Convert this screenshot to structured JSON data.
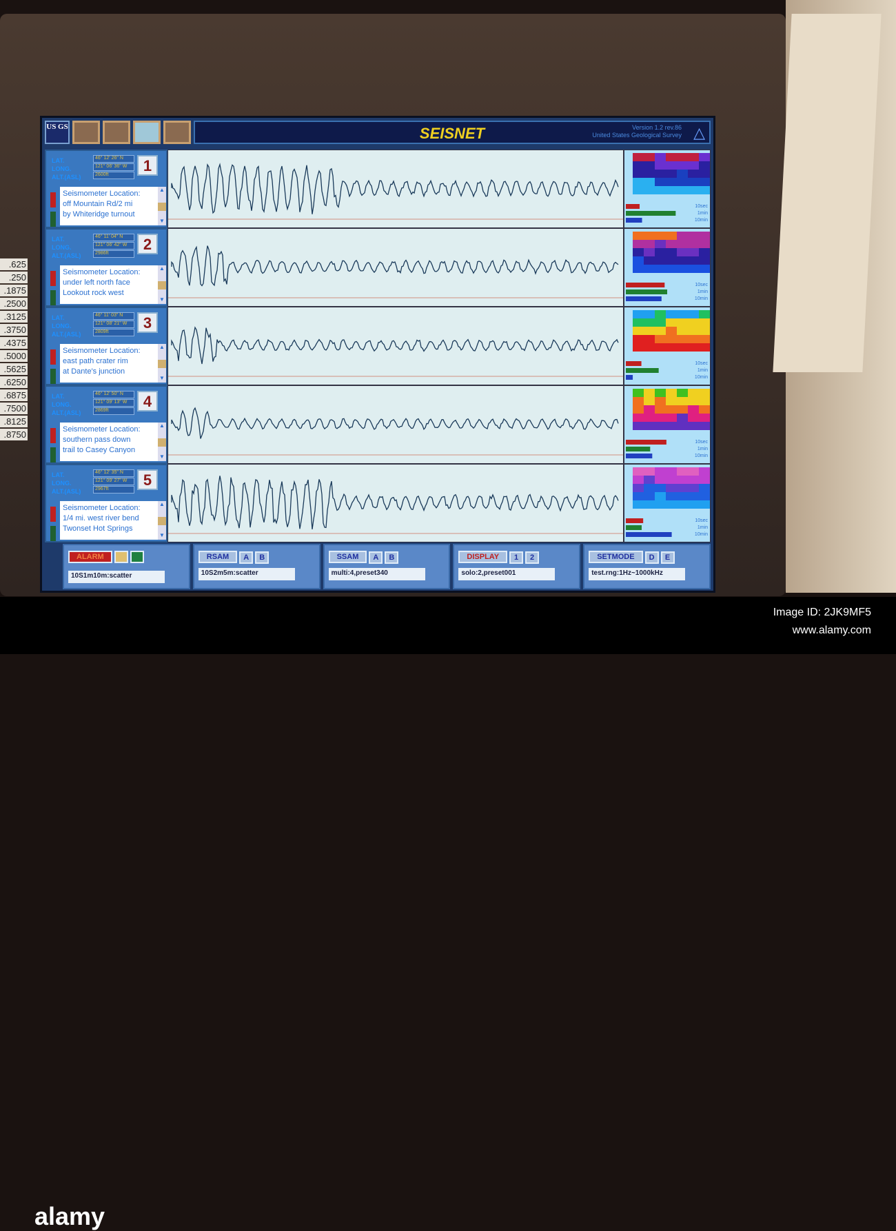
{
  "scale_labels": [
    ".625",
    ".250",
    ".1875",
    ".2500",
    ".3125",
    ".3750",
    ".4375",
    ".5000",
    ".5625",
    ".6250",
    ".6875",
    ".7500",
    ".8125",
    ".8750"
  ],
  "header": {
    "logo": "US GS",
    "title": "SEISNET",
    "version": "Version 1.2 rev.86",
    "org": "United States Geological Survey",
    "tri_icon": "△"
  },
  "field_labels": {
    "lat": "LAT.",
    "long": "LONG.",
    "alt": "ALT.(ASL)"
  },
  "stations": [
    {
      "num": "1",
      "lat": "46° 12' 26\" N",
      "long": "121° 06' 36\" W",
      "alt": "2600ft",
      "desc": [
        "Seismometer Location:",
        "off Mountain Rd/2 mi",
        "by Whiteridge turnout"
      ],
      "amp": [
        1,
        0.3
      ],
      "burst": 0.35
    },
    {
      "num": "2",
      "lat": "46° 11' 04\" N",
      "long": "121° 06' 42\" W",
      "alt": "2986ft",
      "desc": [
        "Seismometer Location:",
        "under left north face",
        "Lookout rock west"
      ],
      "amp": [
        0.8,
        0.25
      ],
      "burst": 0.1
    },
    {
      "num": "3",
      "lat": "46° 11' 03\" N",
      "long": "121° 08' 21\" W",
      "alt": "2809ft",
      "desc": [
        "Seismometer Location:",
        "east path crater rim",
        "at Dante's junction"
      ],
      "amp": [
        0.7,
        0.22
      ],
      "burst": 0.08
    },
    {
      "num": "4",
      "lat": "46° 12' 50\" N",
      "long": "121° 09' 13\" W",
      "alt": "2869ft",
      "desc": [
        "Seismometer Location:",
        "southern pass down",
        "trail to Casey Canyon"
      ],
      "amp": [
        0.6,
        0.2
      ],
      "burst": 0.06
    },
    {
      "num": "5",
      "lat": "46° 12' 35\" N",
      "long": "121° 09' 27\" W",
      "alt": "2967ft",
      "desc": [
        "Seismometer Location:",
        "1/4 mi. west river bend",
        "Twonset Hot Springs"
      ],
      "amp": [
        1,
        0.3
      ],
      "burst": 0.33
    }
  ],
  "spectro_palettes": [
    [
      "#2ab0f0",
      "#1a40c0",
      "#2a20a0",
      "#6a30d0",
      "#c02040"
    ],
    [
      "#1a50e0",
      "#2a20a0",
      "#6a30c0",
      "#b030a0",
      "#f07020"
    ],
    [
      "#e02020",
      "#f07020",
      "#f0d020",
      "#20c060",
      "#20a0f0"
    ],
    [
      "#6030c0",
      "#e02080",
      "#f07020",
      "#f0d020",
      "#40c020"
    ],
    [
      "#20a0f0",
      "#2060e0",
      "#6040d0",
      "#c040d0",
      "#e060c0"
    ]
  ],
  "bar_labels": [
    "10sec",
    "1min",
    "10min"
  ],
  "bar_colors": [
    "#c02020",
    "#208030",
    "#2040c0"
  ],
  "toolbar": {
    "alarm": {
      "label": "ALARM",
      "field": "10S1m10m:scatter"
    },
    "rsam": {
      "label": "RSAM",
      "a": "A",
      "b": "B",
      "field": "10S2m5m:scatter"
    },
    "ssam": {
      "label": "SSAM",
      "a": "A",
      "b": "B",
      "field": "multi:4,preset340"
    },
    "display": {
      "label": "DISPLAY",
      "a": "1",
      "b": "2",
      "field": "solo:2,preset001"
    },
    "setmode": {
      "label": "SETMODE",
      "a": "D",
      "b": "E",
      "field": "test.rng:1Hz~1000kHz"
    }
  },
  "footer": {
    "brand": "alamy",
    "image_id": "Image ID: 2JK9MF5",
    "url": "www.alamy.com"
  }
}
